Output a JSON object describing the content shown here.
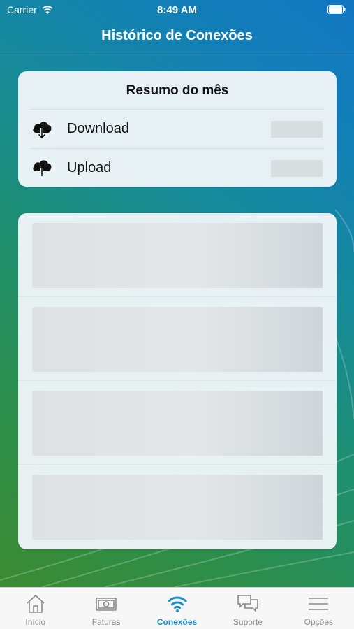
{
  "status_bar": {
    "carrier": "Carrier",
    "time": "8:49 AM"
  },
  "header": {
    "title": "Histórico de Conexões"
  },
  "summary": {
    "title": "Resumo do mês",
    "rows": [
      {
        "label": "Download",
        "icon": "cloud-download-icon"
      },
      {
        "label": "Upload",
        "icon": "cloud-upload-icon"
      }
    ]
  },
  "history_list": {
    "loading_rows": 4
  },
  "tabs": [
    {
      "label": "Início",
      "icon": "home-icon",
      "active": false
    },
    {
      "label": "Faturas",
      "icon": "bill-icon",
      "active": false
    },
    {
      "label": "Conexões",
      "icon": "wifi-icon",
      "active": true
    },
    {
      "label": "Suporte",
      "icon": "chat-icon",
      "active": false
    },
    {
      "label": "Opções",
      "icon": "menu-icon",
      "active": false
    }
  ],
  "colors": {
    "accent": "#1a90c8",
    "tab_inactive": "#8a8a8a"
  }
}
